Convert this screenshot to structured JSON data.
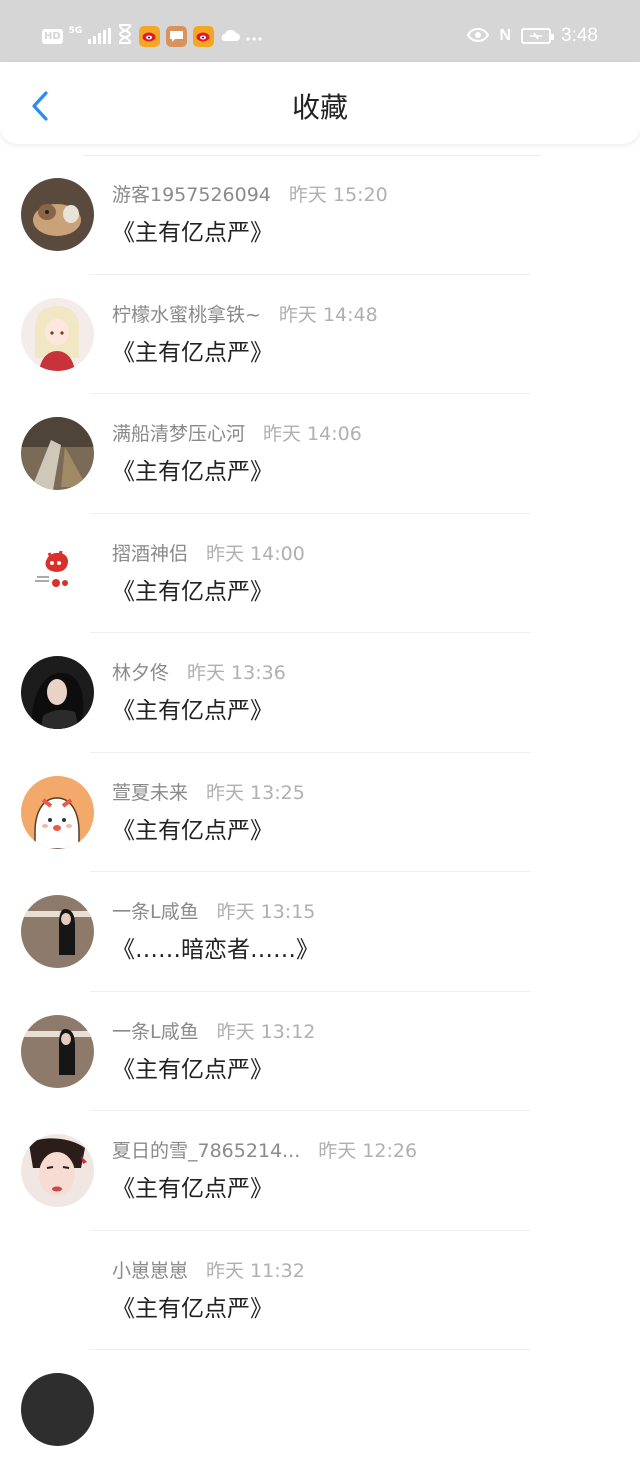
{
  "status_bar": {
    "hd": "HD",
    "signal": "5G",
    "time": "3:48",
    "nfc": "N",
    "icons": [
      "hd-icon",
      "signal-icon",
      "hourglass-icon",
      "weibo-icon",
      "message-icon",
      "weibo-icon",
      "cloud-icon",
      "more-icon",
      "eye-icon",
      "nfc-icon",
      "battery-icon"
    ]
  },
  "nav": {
    "title": "收藏",
    "back_icon": "chevron-left-icon"
  },
  "items": [
    {
      "name": "游客1957526094",
      "time": "昨天 15:20",
      "title": "《主有亿点严》",
      "avatar": "dog"
    },
    {
      "name": "柠檬水蜜桃拿铁~",
      "time": "昨天 14:48",
      "title": "《主有亿点严》",
      "avatar": "anime-girl"
    },
    {
      "name": "满船清梦压心河",
      "time": "昨天 14:06",
      "title": "《主有亿点严》",
      "avatar": "photo"
    },
    {
      "name": "摺酒神侣",
      "time": "昨天 14:00",
      "title": "《主有亿点严》",
      "avatar": "cartoon-red"
    },
    {
      "name": "林夕佟",
      "time": "昨天 13:36",
      "title": "《主有亿点严》",
      "avatar": "girl-dark"
    },
    {
      "name": "萱夏未来",
      "time": "昨天 13:25",
      "title": "《主有亿点严》",
      "avatar": "cartoon-dog"
    },
    {
      "name": "一条L咸鱼",
      "time": "昨天 13:15",
      "title": "《……暗恋者……》",
      "avatar": "girl-street"
    },
    {
      "name": "一条L咸鱼",
      "time": "昨天 13:12",
      "title": "《主有亿点严》",
      "avatar": "girl-street"
    },
    {
      "name": "夏日的雪_7865214...",
      "time": "昨天 12:26",
      "title": "《主有亿点严》",
      "avatar": "girl-face"
    },
    {
      "name": "小崽崽崽",
      "time": "昨天 11:32",
      "title": "《主有亿点严》",
      "avatar": "blank"
    }
  ]
}
